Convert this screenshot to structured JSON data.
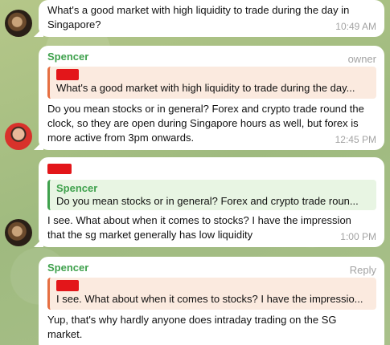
{
  "messages": [
    {
      "text": "What's a good market with high liquidity to trade during the day in Singapore?",
      "time": "10:49 AM"
    },
    {
      "sender": "Spencer",
      "role": "owner",
      "quote": "What's a good market with high liquidity to trade during the day...",
      "text": "Do you mean stocks or in general? Forex and crypto trade round the clock, so they are open during Singapore hours as well, but forex is more active from 3pm onwards.",
      "time": "12:45 PM"
    },
    {
      "quote_sender": "Spencer",
      "quote": "Do you mean stocks or in general? Forex and crypto trade roun...",
      "text": "I see. What about when it comes to stocks? I have the impression that the sg market generally has low liquidity",
      "time": "1:00 PM"
    },
    {
      "sender": "Spencer",
      "action": "Reply",
      "quote": "I see. What about when it comes to stocks? I have the impressio...",
      "text": "Yup, that's why hardly anyone does intraday trading on the SG market."
    }
  ]
}
